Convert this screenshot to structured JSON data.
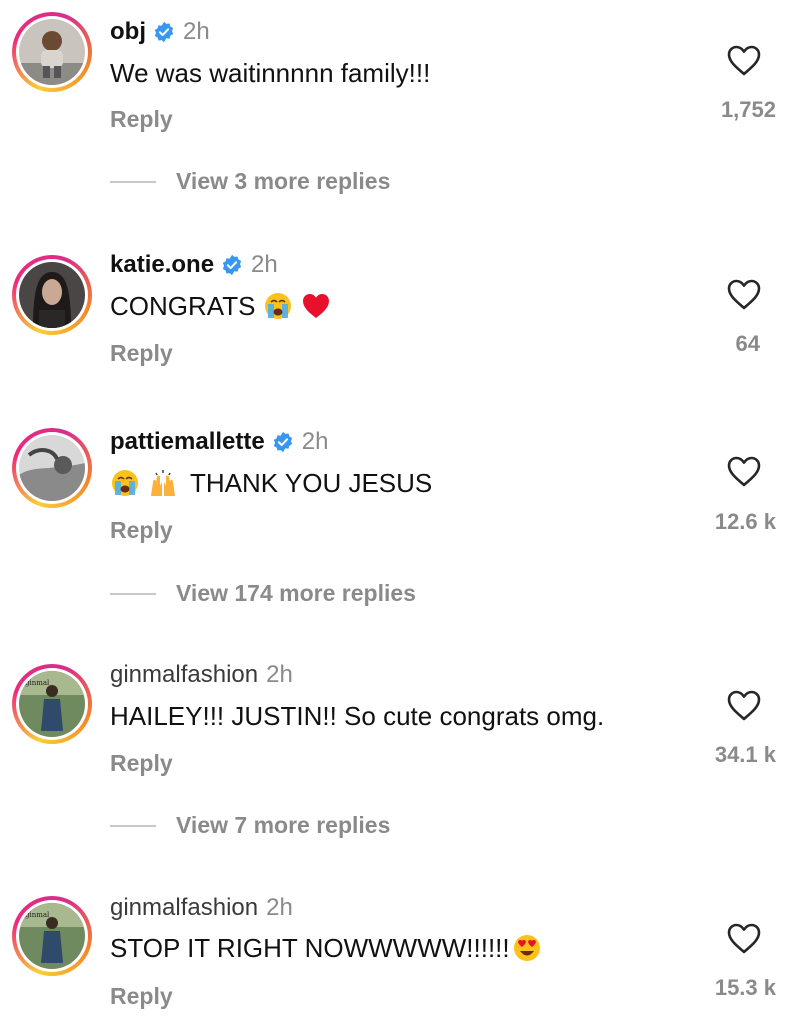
{
  "comments": [
    {
      "username": "obj",
      "verified": true,
      "time": "2h",
      "text": "We was waitinnnnn family!!!",
      "emojis": [],
      "reply_label": "Reply",
      "like_count": "1,752",
      "view_replies": "View 3 more replies"
    },
    {
      "username": "katie.one",
      "verified": true,
      "time": "2h",
      "text": "CONGRATS",
      "emojis": [
        "crying-face",
        "red-heart"
      ],
      "reply_label": "Reply",
      "like_count": "64",
      "view_replies": ""
    },
    {
      "username": "pattiemallette",
      "verified": true,
      "time": "2h",
      "text": "THANK YOU JESUS",
      "emojis": [
        "crying-face",
        "raising-hands"
      ],
      "reply_label": "Reply",
      "like_count": "12.6 k",
      "view_replies": "View 174 more replies"
    },
    {
      "username": "ginmalfashion",
      "verified": false,
      "time": "2h",
      "text": "HAILEY!!! JUSTIN!! So cute congrats omg.",
      "emojis": [],
      "reply_label": "Reply",
      "like_count": "34.1 k",
      "view_replies": "View 7 more replies"
    },
    {
      "username": "ginmalfashion",
      "verified": false,
      "time": "2h",
      "text": "STOP IT RIGHT NOWWWWW!!!!!!",
      "emojis": [
        "heart-eyes-face"
      ],
      "reply_label": "Reply",
      "like_count": "15.3 k",
      "view_replies": ""
    }
  ],
  "colors": {
    "verified_blue": "#3897f0",
    "secondary_text": "#8a8a8a",
    "divider": "#c8c8c8"
  }
}
